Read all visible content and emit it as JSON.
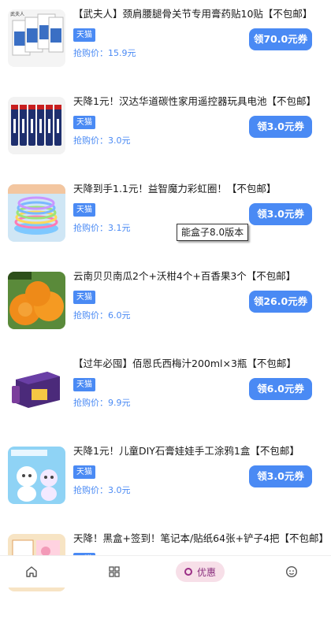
{
  "items": [
    {
      "title": "【武夫人】颈肩腰腿骨关节专用膏药贴10贴【不包邮】",
      "badge": "天猫",
      "price": "抢购价：15.9元",
      "coupon": "领70.0元券",
      "image": "plaster-box-image"
    },
    {
      "title": "天降1元！汉达华道碳性家用遥控器玩具电池【不包邮】",
      "badge": "天猫",
      "price": "抢购价：3.0元",
      "coupon": "领3.0元券",
      "image": "batteries-image"
    },
    {
      "title": "天降到手1.1元！益智魔力彩虹圈！【不包邮】",
      "badge": "天猫",
      "price": "抢购价：3.1元",
      "coupon": "领3.0元券",
      "image": "rainbow-slinky-image"
    },
    {
      "title": "云南贝贝南瓜2个+沃柑4个+百香果3个【不包邮】",
      "badge": "天猫",
      "price": "抢购价：6.0元",
      "coupon": "领26.0元券",
      "image": "oranges-image"
    },
    {
      "title": "【过年必囤】佰恩氏西梅汁200ml×3瓶【不包邮】",
      "badge": "天猫",
      "price": "抢购价：9.9元",
      "coupon": "领6.0元券",
      "image": "prune-juice-box-image"
    },
    {
      "title": "天降1元！儿童DIY石膏娃娃手工涂鸦1盒【不包邮】",
      "badge": "天猫",
      "price": "抢购价：3.0元",
      "coupon": "领3.0元券",
      "image": "plaster-doll-image"
    },
    {
      "title": "天降！黑盒+签到！笔记本/贴纸64张+铲子4把【不包邮】",
      "badge": "天猫",
      "price": "",
      "coupon": "",
      "image": "notebook-stickers-image"
    }
  ],
  "tooltip": "能盒子8.0版本",
  "tabbar": {
    "home_icon": "home-icon",
    "grid_icon": "grid-icon",
    "active_label": "优惠",
    "profile_icon": "profile-icon"
  },
  "colors": {
    "accent": "#4a8af4",
    "active_tab_bg": "#f7dfe8",
    "active_tab_text": "#8a2f7e"
  }
}
